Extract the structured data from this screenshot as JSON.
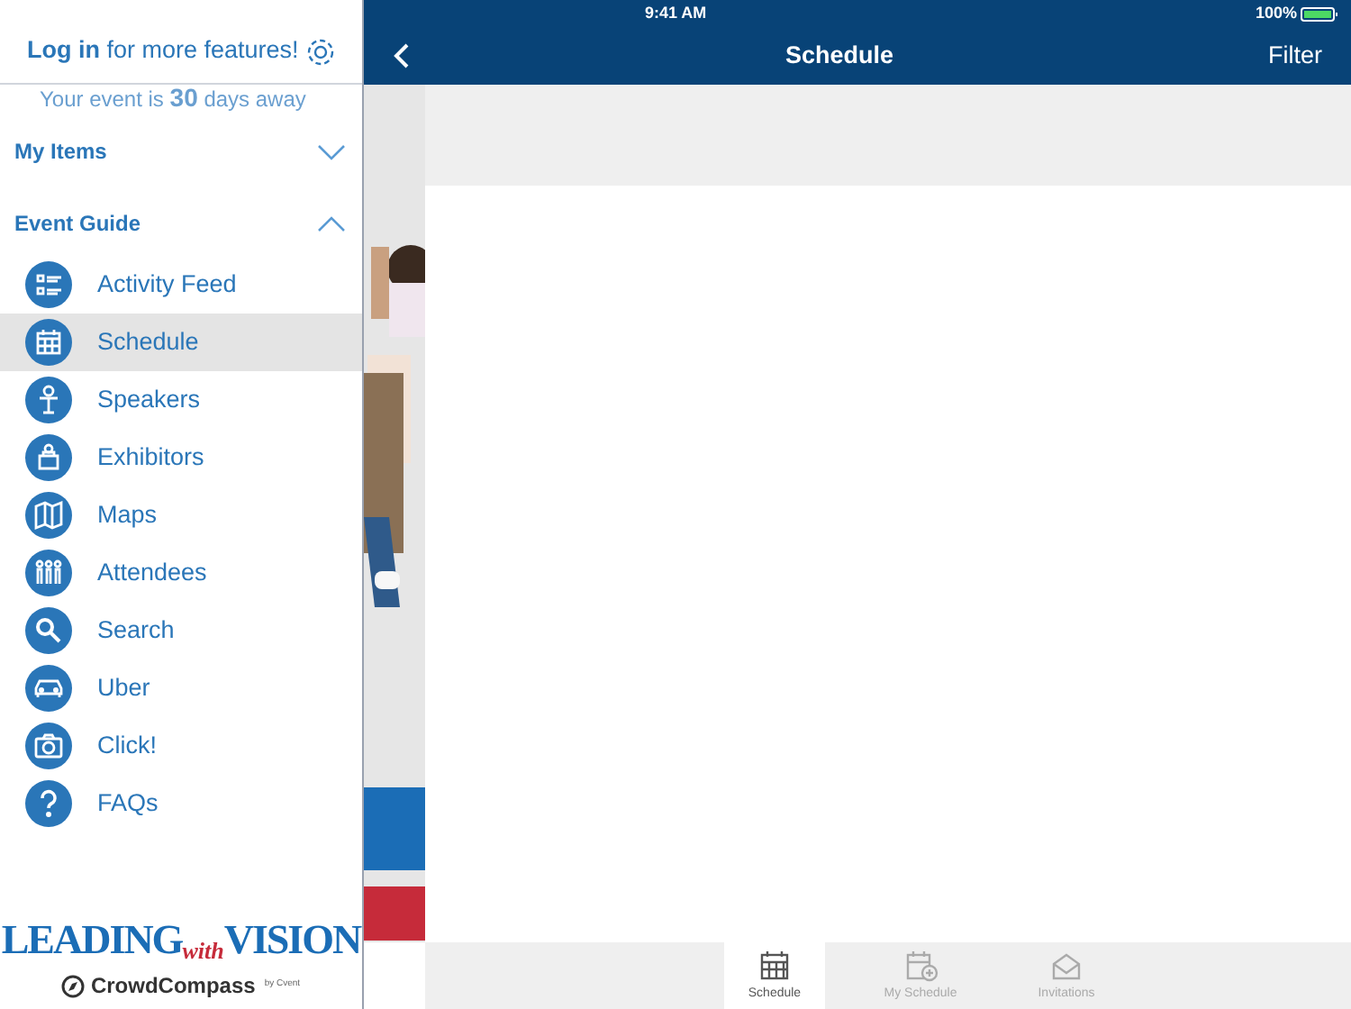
{
  "sidebar": {
    "login": {
      "link": "Log in",
      "text": "for more features!"
    },
    "countdown": {
      "before": "Your event is",
      "number": "30",
      "after": "days away"
    },
    "sections": [
      {
        "title": "My Items",
        "expanded": false
      },
      {
        "title": "Event Guide",
        "expanded": true
      }
    ],
    "items": [
      {
        "label": "Activity Feed",
        "kind": "feed",
        "selected": false
      },
      {
        "label": "Schedule",
        "kind": "calendar",
        "selected": true
      },
      {
        "label": "Speakers",
        "kind": "speaker",
        "selected": false
      },
      {
        "label": "Exhibitors",
        "kind": "booth",
        "selected": false
      },
      {
        "label": "Maps",
        "kind": "map",
        "selected": false
      },
      {
        "label": "Attendees",
        "kind": "people",
        "selected": false
      },
      {
        "label": "Search",
        "kind": "search",
        "selected": false
      },
      {
        "label": "Uber",
        "kind": "car",
        "selected": false
      },
      {
        "label": "Click!",
        "kind": "camera",
        "selected": false
      },
      {
        "label": "FAQs",
        "kind": "question",
        "selected": false
      }
    ],
    "logo": {
      "word1": "LEADING",
      "word2": "with",
      "word3": "VISION"
    },
    "brand": {
      "name": "CrowdCompass",
      "by": "by Cvent"
    }
  },
  "status_bar": {
    "time": "9:41 AM",
    "battery": "100%"
  },
  "nav": {
    "title": "Schedule",
    "action": "Filter"
  },
  "tabs": [
    {
      "label": "Schedule",
      "kind": "calendar",
      "selected": true
    },
    {
      "label": "My Schedule",
      "kind": "calendar-plus",
      "selected": false
    },
    {
      "label": "Invitations",
      "kind": "envelope",
      "selected": false
    }
  ]
}
